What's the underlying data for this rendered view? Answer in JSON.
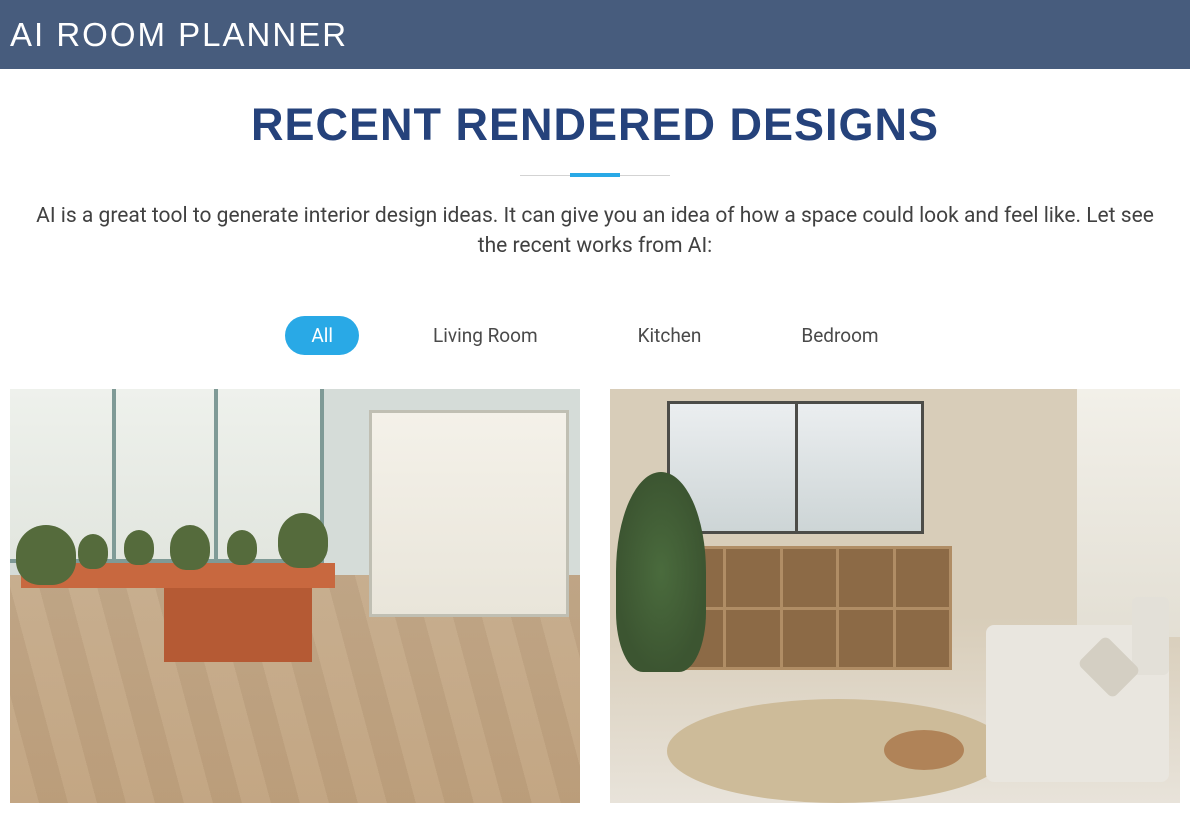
{
  "header": {
    "logo": "AI ROOM PLANNER"
  },
  "main": {
    "title": "RECENT RENDERED DESIGNS",
    "description": "AI is a great tool to generate interior design ideas. It can give you an idea of how a space could look and feel like. Let see the recent works from AI:",
    "filters": {
      "all": "All",
      "living_room": "Living Room",
      "kitchen": "Kitchen",
      "bedroom": "Bedroom"
    }
  }
}
